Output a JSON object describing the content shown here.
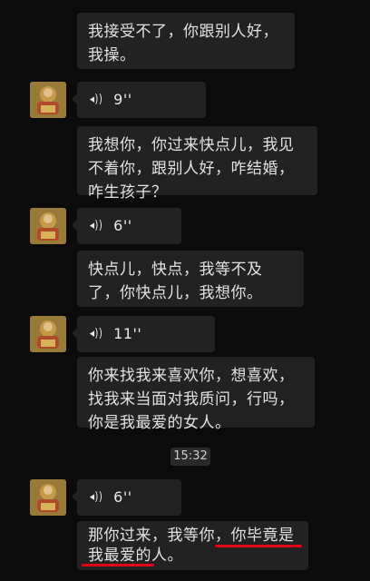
{
  "messages": [
    {
      "type": "text",
      "text": "我接受不了，你跟别人好，我操。"
    },
    {
      "type": "voice",
      "duration": "9''"
    },
    {
      "type": "text",
      "text": "我想你，你过来快点儿，我见不着你，跟别人好，咋结婚，咋生孩子？"
    },
    {
      "type": "voice",
      "duration": "6''"
    },
    {
      "type": "text",
      "text": "快点儿，快点，我等不及了，你快点儿，我想你。"
    },
    {
      "type": "voice",
      "duration": "11''"
    },
    {
      "type": "text",
      "text": "你来找我来喜欢你，想喜欢，找我来当面对我质问，行吗，你是我最爱的女人。"
    },
    {
      "type": "voice",
      "duration": "6''"
    },
    {
      "type": "text",
      "text": "那你过来，我等你，你毕竟是我最爱的人。"
    }
  ],
  "timestamp": "15:32",
  "colors": {
    "bubble": "#222222",
    "background": "#0b0b0b",
    "underline": "#e0001b"
  },
  "icons": [
    "voice-wave-icon",
    "avatar"
  ]
}
